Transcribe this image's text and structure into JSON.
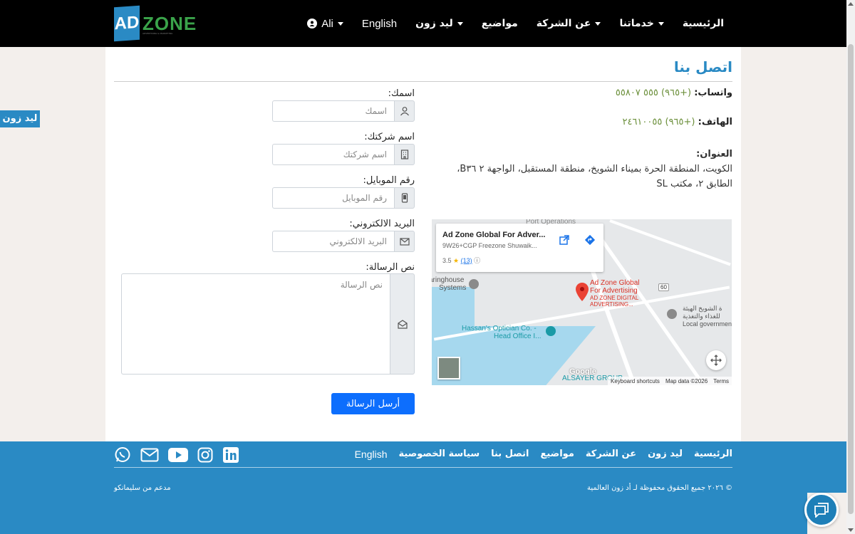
{
  "header": {
    "logo": {
      "ad": "AD",
      "zone": "ZONE",
      "tagline": "ADVERTISING & MARKETING"
    },
    "nav": [
      {
        "label": "الرئيسية",
        "dropdown": false
      },
      {
        "label": "خدماتنا",
        "dropdown": true
      },
      {
        "label": "عن الشركة",
        "dropdown": true
      },
      {
        "label": "مواضيع",
        "dropdown": false
      },
      {
        "label": "ليد زون",
        "dropdown": true
      },
      {
        "label": "English",
        "dropdown": false
      },
      {
        "label": "Ali",
        "dropdown": true
      }
    ]
  },
  "side_tab": {
    "label": "ليد زون"
  },
  "page": {
    "title": "اتصل بنا"
  },
  "contact": {
    "whatsapp_label": "واتساب:",
    "whatsapp_value": "(+٩٦٥) ٥٥٥ ٥٥٨٠٧",
    "phone_label": "الهاتف:",
    "phone_value": "(+٩٦٥) ٢٤٦١٠٠٥٥",
    "address_label": "العنوان:",
    "address_value": "الكويت، المنطقة الحرة بميناء الشويخ، منطقة المستقبل، الواجهة ٢ B٣٦، الطابق ٢، مكتب SL"
  },
  "map": {
    "place_title": "Ad Zone Global For Adver...",
    "place_address": "9W26+CGP Freezone Shuwaik...",
    "rating": "3.5",
    "reviews": "(13)",
    "labels": {
      "pin_title_1": "Ad Zone Global",
      "pin_title_2": "For Advertising",
      "pin_sub_1": "AD ZONE DIGITAL",
      "pin_sub_2": "ADVERTISING...",
      "clearing_1": "aringhouse",
      "clearing_2": "Systems",
      "optician_1": "Hassan's Optician Co. -",
      "optician_2": "Head Office I...",
      "gov_1": "ة الشويخ الهيئة",
      "gov_2": "للغذاء والتغذية",
      "gov_3": "Local government",
      "port": "Port Operations",
      "road": "60",
      "alsayer": "ALSAYER GROUP",
      "google": "Google"
    },
    "footer": {
      "shortcuts": "Keyboard shortcuts",
      "data": "Map data ©2026",
      "terms": "Terms"
    }
  },
  "form": {
    "name_label": "اسمك:",
    "name_placeholder": "اسمك",
    "company_label": "اسم شركتك:",
    "company_placeholder": "اسم شركتك",
    "mobile_label": "رقم الموبايل:",
    "mobile_placeholder": "رقم الموبايل",
    "email_label": "البريد الالكتروني:",
    "email_placeholder": "البريد الالكتروني",
    "message_label": "نص الرسالة:",
    "message_placeholder": "نص الرسالة",
    "submit_label": "أرسل الرسالة"
  },
  "footer": {
    "links": [
      "الرئيسية",
      "ليد زون",
      "عن الشركة",
      "مواضيع",
      "اتصل بنا",
      "سياسة الخصوصية",
      "English"
    ],
    "copyright": "© ٢٠٢٦ جميع الحقوق محفوظة لـ أد زون العالمية",
    "powered": "مدعم من سليمانكو",
    "social": [
      "whatsapp-icon",
      "mail-icon",
      "youtube-icon",
      "instagram-icon",
      "linkedin-icon"
    ]
  },
  "colors": {
    "brand_blue": "#2a8ac4",
    "header_bg": "#000000",
    "green_value": "#6b8f3a",
    "button_blue": "#0d6efd"
  }
}
